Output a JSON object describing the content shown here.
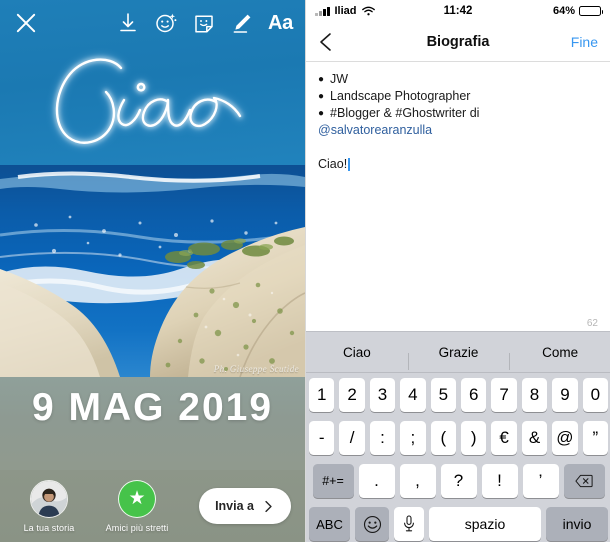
{
  "story": {
    "toolbar": {
      "close_icon": "close-icon",
      "icons": [
        {
          "name": "download-icon",
          "label": "Salva"
        },
        {
          "name": "effects-face-icon",
          "label": "Effetti"
        },
        {
          "name": "sticker-icon",
          "label": "Adesivo"
        },
        {
          "name": "draw-pen-icon",
          "label": "Disegna"
        }
      ],
      "text_tool_label": "Aa"
    },
    "overlay_text": "Ciao",
    "date_text": "9 MAG 2019",
    "watermark": "Ph. Giuseppe Scutide",
    "destinations": [
      {
        "name": "your-story",
        "label": "La tua storia"
      },
      {
        "name": "close-friends",
        "label": "Amici più stretti",
        "color": "#46c34a",
        "icon": "star-icon"
      }
    ],
    "send_button": {
      "label": "Invia a",
      "icon": "chevron-right-icon"
    }
  },
  "phone": {
    "statusbar": {
      "carrier": "Iliad",
      "time": "11:42",
      "battery_percent": "64%",
      "battery_level": 64,
      "wifi_icon": "wifi-icon",
      "signal_icon": "signal-bars-icon"
    },
    "navbar": {
      "back_icon": "chevron-left-icon",
      "title": "Biografia",
      "done_label": "Fine",
      "done_color": "#3897f0"
    },
    "bio": {
      "bullet": "●",
      "lines": [
        {
          "bullet": true,
          "text": "JW"
        },
        {
          "bullet": true,
          "text": "Landscape Photographer"
        },
        {
          "bullet": true,
          "text": "#Blogger & #Ghostwriter di"
        },
        {
          "bullet": false,
          "text": "@salvatorearanzulla",
          "mention": true
        }
      ],
      "editing_text": "Ciao!",
      "char_counter": "62"
    },
    "keyboard": {
      "predictions": [
        "Ciao",
        "Grazie",
        "Come"
      ],
      "row1": [
        "1",
        "2",
        "3",
        "4",
        "5",
        "6",
        "7",
        "8",
        "9",
        "0"
      ],
      "row2": [
        "-",
        "/",
        ":",
        ";",
        "(",
        ")",
        "€",
        "&",
        "@",
        "”"
      ],
      "row3_symbols_label": "#+=",
      "row3": [
        ".",
        ",",
        "?",
        "!",
        "’"
      ],
      "row3_delete_icon": "delete-backspace-icon",
      "row4": {
        "abc_label": "ABC",
        "emoji_icon": "emoji-smiley-icon",
        "mic_icon": "microphone-icon",
        "space_label": "spazio",
        "enter_label": "invio"
      }
    }
  }
}
